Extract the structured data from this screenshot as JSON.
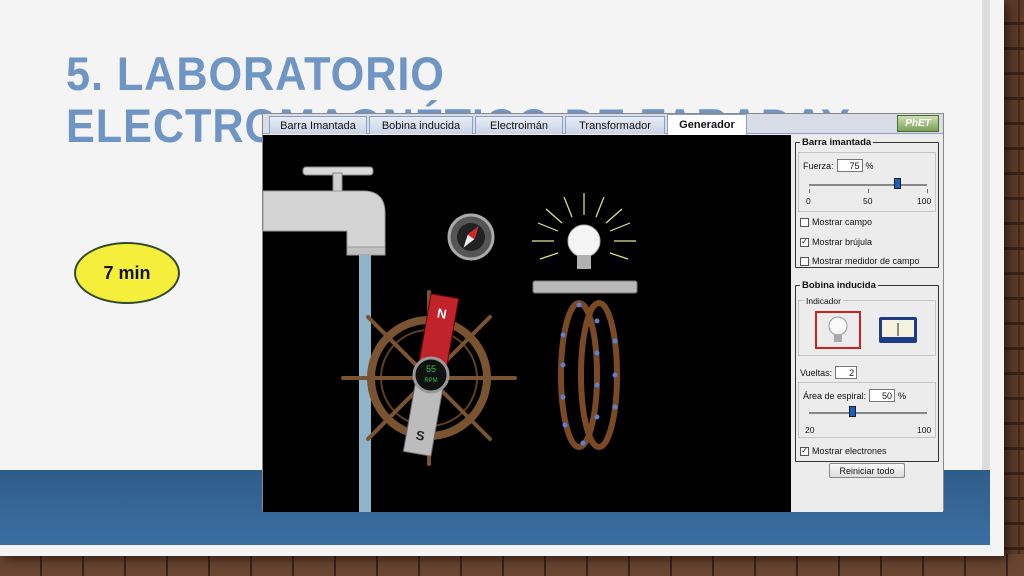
{
  "slide": {
    "title": "5. Laboratorio electromagnético de Faraday",
    "time_badge": "7 min",
    "colors": {
      "title": "#6f95c4",
      "band": "#2f5d8a",
      "badge": "#f5ee3a"
    }
  },
  "sim": {
    "tabs": [
      {
        "label": "Barra Imantada",
        "active": false
      },
      {
        "label": "Bobina inducida",
        "active": false
      },
      {
        "label": "Electroimán",
        "active": false
      },
      {
        "label": "Transformador",
        "active": false
      },
      {
        "label": "Generador",
        "active": true
      }
    ],
    "logo": "PhET",
    "canvas": {
      "magnet_north": "N",
      "magnet_south": "S",
      "rpm_value": "55",
      "rpm_unit": "RPM"
    },
    "bar_magnet": {
      "title": "Barra imantada",
      "strength_label": "Fuerza:",
      "strength_value": "75",
      "strength_unit": "%",
      "strength_fraction": 0.75,
      "ticks": [
        "0",
        "50",
        "100"
      ],
      "options": [
        {
          "label": "Mostrar campo",
          "checked": false
        },
        {
          "label": "Mostrar brújula",
          "checked": true
        },
        {
          "label": "Mostrar medidor de campo",
          "checked": false
        }
      ]
    },
    "pickup_coil": {
      "title": "Bobina inducida",
      "indicator_label": "Indicador",
      "indicators": [
        {
          "name": "bulb",
          "selected": true
        },
        {
          "name": "voltmeter",
          "selected": false
        }
      ],
      "loops_label": "Vueltas:",
      "loops_value": "2",
      "area_label": "Área de espiral:",
      "area_value": "50",
      "area_unit": "%",
      "area_fraction": 0.375,
      "area_min": "20",
      "area_max": "100",
      "electrons_label": "Mostrar electrones",
      "electrons_checked": true
    },
    "reset_label": "Reiniciar todo"
  }
}
